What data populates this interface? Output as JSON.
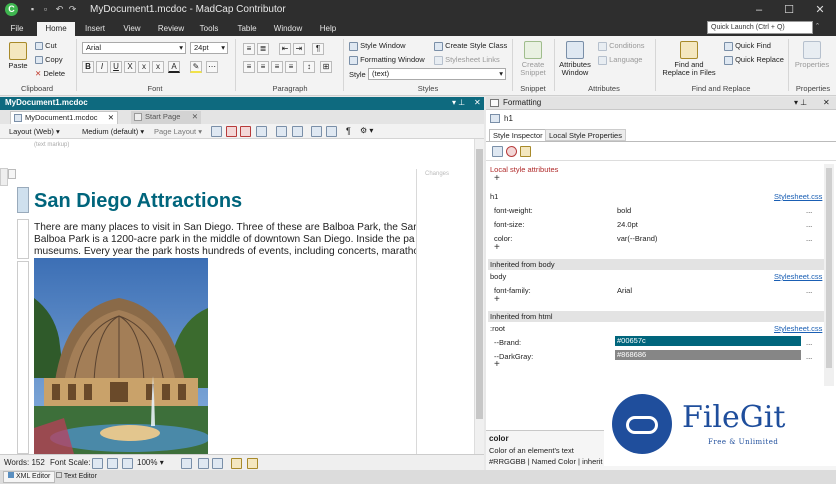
{
  "app": {
    "document_title": "MyDocument1.mcdoc",
    "app_name": "MadCap Contributor",
    "title_separator": "-",
    "quick_launch_placeholder": "Quick Launch (Ctrl + Q)"
  },
  "menu": [
    "File",
    "Home",
    "Insert",
    "View",
    "Review",
    "Tools",
    "Table",
    "Window",
    "Help"
  ],
  "ribbon": {
    "clipboard": {
      "paste": "Paste",
      "cut": "Cut",
      "copy": "Copy",
      "delete": "Delete",
      "label": "Clipboard"
    },
    "font": {
      "family": "Arial",
      "size": "24pt",
      "label": "Font"
    },
    "paragraph": {
      "label": "Paragraph"
    },
    "styles": {
      "style_window": "Style Window",
      "formatting_window": "Formatting Window",
      "create_style_class": "Create Style Class",
      "stylesheet_links": "Stylesheet Links",
      "style_label": "Style",
      "style_value": "(text)",
      "label": "Styles"
    },
    "snippet": {
      "create_snippet_line1": "Create",
      "create_snippet_line2": "Snippet",
      "label": "Snippet"
    },
    "attributes": {
      "attributes_window_line1": "Attributes",
      "attributes_window_line2": "Window",
      "conditions": "Conditions",
      "language": "Language",
      "label": "Attributes"
    },
    "find_replace": {
      "find_line1": "Find and",
      "find_line2": "Replace in Files",
      "quick_find": "Quick Find",
      "quick_replace": "Quick Replace",
      "label": "Find and Replace"
    },
    "properties": {
      "button": "Properties",
      "label": "Properties"
    }
  },
  "doc_pane": {
    "title": "MyDocument1.mcdoc",
    "tabs": [
      {
        "label": "MyDocument1.mcdoc",
        "active": true
      },
      {
        "label": "Start Page",
        "active": false
      }
    ],
    "toolbar": {
      "layout": "Layout (Web)",
      "medium": "Medium (default)",
      "page_layout": "Page Layout"
    },
    "markup_hint": "(text markup)",
    "changes_label": "Changes",
    "heading": "San Diego Attractions",
    "paragraph_lines": [
      "There are many places to visit in San Diego. Three of these are Balboa Park, the Sar",
      "Balboa Park is a 1200-acre park in the middle of downtown San Diego. Inside the pa",
      "museums. Every year the park hosts hundreds of events, including concerts, maratho"
    ],
    "status": {
      "words_label": "Words:",
      "words": "152",
      "font_scale_label": "Font Scale:",
      "zoom": "100%"
    }
  },
  "bottom_tabs": [
    "XML Editor",
    "Text Editor"
  ],
  "formatting": {
    "title": "Formatting",
    "selected_element": "h1",
    "tabs": [
      "Style Inspector",
      "Local Style Properties"
    ],
    "local_label": "Local style attributes",
    "groups": [
      {
        "header": "h1",
        "header_style": "plain",
        "source": "Stylesheet.css",
        "props": [
          {
            "name": "font-weight:",
            "value": "bold"
          },
          {
            "name": "font-size:",
            "value": "24.0pt"
          },
          {
            "name": "color:",
            "value": "var(--Brand)"
          }
        ]
      },
      {
        "header": "Inherited from body",
        "header_style": "band"
      },
      {
        "header": "body",
        "header_style": "plain",
        "source": "Stylesheet.css",
        "props": [
          {
            "name": "font-family:",
            "value": "Arial"
          }
        ]
      },
      {
        "header": "Inherited from html",
        "header_style": "band"
      },
      {
        "header": ":root",
        "header_style": "plain",
        "source": "Stylesheet.css",
        "props": [
          {
            "name": "--Brand:",
            "value": "#00657c",
            "swatch": "#00657c"
          },
          {
            "name": "--DarkGray:",
            "value": "#868686",
            "swatch": "#868686"
          }
        ]
      }
    ],
    "help": {
      "title": "color",
      "description": "Color of an element's text",
      "syntax": "#RRGGBB | Named Color | inherit"
    }
  },
  "watermark": {
    "brand": "FileGit",
    "tagline": "Free & Unlimited"
  },
  "colors": {
    "brand_teal": "#0e6a7f",
    "heading": "#00657c",
    "titlebar": "#2e2e2e",
    "watermark_blue": "#1f4e9c"
  }
}
